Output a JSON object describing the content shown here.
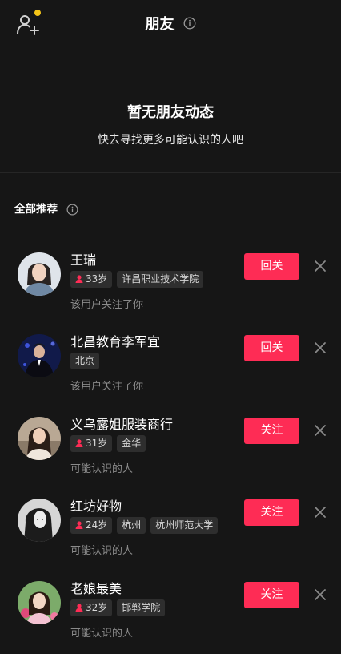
{
  "header": {
    "title": "朋友"
  },
  "empty_state": {
    "title": "暂无朋友动态",
    "subtitle": "快去寻找更多可能认识的人吧"
  },
  "section": {
    "title": "全部推荐"
  },
  "colors": {
    "accent": "#fe2c55",
    "background": "#161616",
    "notification_dot": "#f5c518"
  },
  "recommendations": [
    {
      "name": "王瑞",
      "age": "33岁",
      "tags": [
        "许昌职业技术学院"
      ],
      "reason": "该用户关注了你",
      "button": "回关"
    },
    {
      "name": "北昌教育李军宜",
      "age": "",
      "tags": [
        "北京"
      ],
      "reason": "该用户关注了你",
      "button": "回关"
    },
    {
      "name": "义乌露姐服装商行",
      "age": "31岁",
      "tags": [
        "金华"
      ],
      "reason": "可能认识的人",
      "button": "关注"
    },
    {
      "name": "红坊好物",
      "age": "24岁",
      "tags": [
        "杭州",
        "杭州师范大学"
      ],
      "reason": "可能认识的人",
      "button": "关注"
    },
    {
      "name": "老娘最美",
      "age": "32岁",
      "tags": [
        "邯郸学院"
      ],
      "reason": "可能认识的人",
      "button": "关注"
    }
  ]
}
